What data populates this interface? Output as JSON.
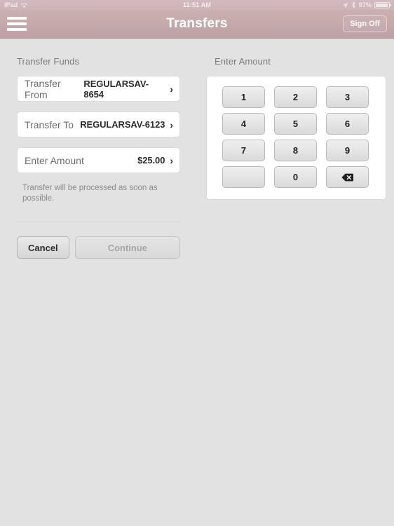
{
  "statusbar": {
    "device_label": "iPad",
    "wifi_icon": "wifi-icon",
    "time": "11:51 AM",
    "location_icon": "location-arrow-icon",
    "bluetooth_icon": "bluetooth-icon",
    "battery_percent": "97%",
    "battery_icon": "battery-icon"
  },
  "navbar": {
    "menu_icon": "hamburger-menu-icon",
    "title": "Transfers",
    "signoff_label": "Sign Off"
  },
  "left_pane": {
    "section_title": "Transfer Funds",
    "rows": [
      {
        "label": "Transfer From",
        "value": "REGULARSAV-8654",
        "chevron": "›"
      },
      {
        "label": "Transfer To",
        "value": "REGULARSAV-6123",
        "chevron": "›"
      },
      {
        "label": "Enter Amount",
        "value": "$25.00",
        "chevron": "›"
      }
    ],
    "note": "Transfer will be processed as soon as possible.",
    "cancel_label": "Cancel",
    "continue_label": "Continue"
  },
  "right_pane": {
    "section_title": "Enter Amount",
    "keys": [
      {
        "label": "1",
        "name": "key-1"
      },
      {
        "label": "2",
        "name": "key-2"
      },
      {
        "label": "3",
        "name": "key-3"
      },
      {
        "label": "4",
        "name": "key-4"
      },
      {
        "label": "5",
        "name": "key-5"
      },
      {
        "label": "6",
        "name": "key-6"
      },
      {
        "label": "7",
        "name": "key-7"
      },
      {
        "label": "8",
        "name": "key-8"
      },
      {
        "label": "9",
        "name": "key-9"
      },
      {
        "label": "",
        "name": "key-blank"
      },
      {
        "label": "0",
        "name": "key-0"
      },
      {
        "label": "",
        "name": "key-backspace"
      }
    ]
  },
  "colors": {
    "navbar_top": "#cbb0b2",
    "navbar_bottom": "#bda2a5",
    "page_background": "#e2e2e2",
    "row_background": "#ffffff",
    "divider": "#c9c9c9"
  }
}
